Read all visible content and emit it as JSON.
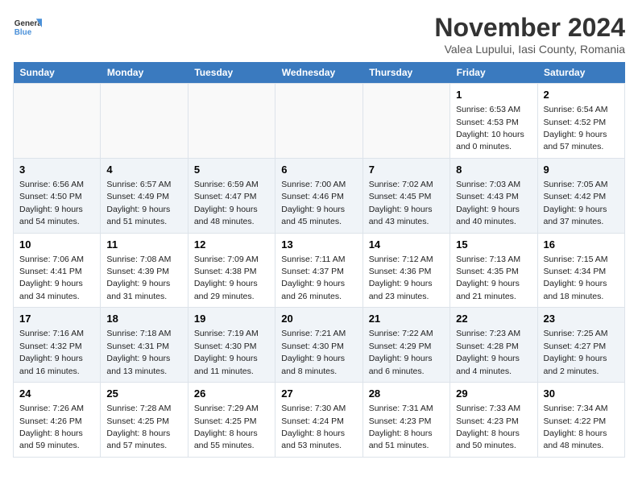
{
  "app": {
    "name": "GeneralBlue",
    "logo_text_1": "General",
    "logo_text_2": "Blue"
  },
  "calendar": {
    "title": "November 2024",
    "subtitle": "Valea Lupului, Iasi County, Romania",
    "days_of_week": [
      "Sunday",
      "Monday",
      "Tuesday",
      "Wednesday",
      "Thursday",
      "Friday",
      "Saturday"
    ],
    "weeks": [
      [
        {
          "day": "",
          "content": ""
        },
        {
          "day": "",
          "content": ""
        },
        {
          "day": "",
          "content": ""
        },
        {
          "day": "",
          "content": ""
        },
        {
          "day": "",
          "content": ""
        },
        {
          "day": "1",
          "content": "Sunrise: 6:53 AM\nSunset: 4:53 PM\nDaylight: 10 hours and 0 minutes."
        },
        {
          "day": "2",
          "content": "Sunrise: 6:54 AM\nSunset: 4:52 PM\nDaylight: 9 hours and 57 minutes."
        }
      ],
      [
        {
          "day": "3",
          "content": "Sunrise: 6:56 AM\nSunset: 4:50 PM\nDaylight: 9 hours and 54 minutes."
        },
        {
          "day": "4",
          "content": "Sunrise: 6:57 AM\nSunset: 4:49 PM\nDaylight: 9 hours and 51 minutes."
        },
        {
          "day": "5",
          "content": "Sunrise: 6:59 AM\nSunset: 4:47 PM\nDaylight: 9 hours and 48 minutes."
        },
        {
          "day": "6",
          "content": "Sunrise: 7:00 AM\nSunset: 4:46 PM\nDaylight: 9 hours and 45 minutes."
        },
        {
          "day": "7",
          "content": "Sunrise: 7:02 AM\nSunset: 4:45 PM\nDaylight: 9 hours and 43 minutes."
        },
        {
          "day": "8",
          "content": "Sunrise: 7:03 AM\nSunset: 4:43 PM\nDaylight: 9 hours and 40 minutes."
        },
        {
          "day": "9",
          "content": "Sunrise: 7:05 AM\nSunset: 4:42 PM\nDaylight: 9 hours and 37 minutes."
        }
      ],
      [
        {
          "day": "10",
          "content": "Sunrise: 7:06 AM\nSunset: 4:41 PM\nDaylight: 9 hours and 34 minutes."
        },
        {
          "day": "11",
          "content": "Sunrise: 7:08 AM\nSunset: 4:39 PM\nDaylight: 9 hours and 31 minutes."
        },
        {
          "day": "12",
          "content": "Sunrise: 7:09 AM\nSunset: 4:38 PM\nDaylight: 9 hours and 29 minutes."
        },
        {
          "day": "13",
          "content": "Sunrise: 7:11 AM\nSunset: 4:37 PM\nDaylight: 9 hours and 26 minutes."
        },
        {
          "day": "14",
          "content": "Sunrise: 7:12 AM\nSunset: 4:36 PM\nDaylight: 9 hours and 23 minutes."
        },
        {
          "day": "15",
          "content": "Sunrise: 7:13 AM\nSunset: 4:35 PM\nDaylight: 9 hours and 21 minutes."
        },
        {
          "day": "16",
          "content": "Sunrise: 7:15 AM\nSunset: 4:34 PM\nDaylight: 9 hours and 18 minutes."
        }
      ],
      [
        {
          "day": "17",
          "content": "Sunrise: 7:16 AM\nSunset: 4:32 PM\nDaylight: 9 hours and 16 minutes."
        },
        {
          "day": "18",
          "content": "Sunrise: 7:18 AM\nSunset: 4:31 PM\nDaylight: 9 hours and 13 minutes."
        },
        {
          "day": "19",
          "content": "Sunrise: 7:19 AM\nSunset: 4:30 PM\nDaylight: 9 hours and 11 minutes."
        },
        {
          "day": "20",
          "content": "Sunrise: 7:21 AM\nSunset: 4:30 PM\nDaylight: 9 hours and 8 minutes."
        },
        {
          "day": "21",
          "content": "Sunrise: 7:22 AM\nSunset: 4:29 PM\nDaylight: 9 hours and 6 minutes."
        },
        {
          "day": "22",
          "content": "Sunrise: 7:23 AM\nSunset: 4:28 PM\nDaylight: 9 hours and 4 minutes."
        },
        {
          "day": "23",
          "content": "Sunrise: 7:25 AM\nSunset: 4:27 PM\nDaylight: 9 hours and 2 minutes."
        }
      ],
      [
        {
          "day": "24",
          "content": "Sunrise: 7:26 AM\nSunset: 4:26 PM\nDaylight: 8 hours and 59 minutes."
        },
        {
          "day": "25",
          "content": "Sunrise: 7:28 AM\nSunset: 4:25 PM\nDaylight: 8 hours and 57 minutes."
        },
        {
          "day": "26",
          "content": "Sunrise: 7:29 AM\nSunset: 4:25 PM\nDaylight: 8 hours and 55 minutes."
        },
        {
          "day": "27",
          "content": "Sunrise: 7:30 AM\nSunset: 4:24 PM\nDaylight: 8 hours and 53 minutes."
        },
        {
          "day": "28",
          "content": "Sunrise: 7:31 AM\nSunset: 4:23 PM\nDaylight: 8 hours and 51 minutes."
        },
        {
          "day": "29",
          "content": "Sunrise: 7:33 AM\nSunset: 4:23 PM\nDaylight: 8 hours and 50 minutes."
        },
        {
          "day": "30",
          "content": "Sunrise: 7:34 AM\nSunset: 4:22 PM\nDaylight: 8 hours and 48 minutes."
        }
      ]
    ]
  }
}
